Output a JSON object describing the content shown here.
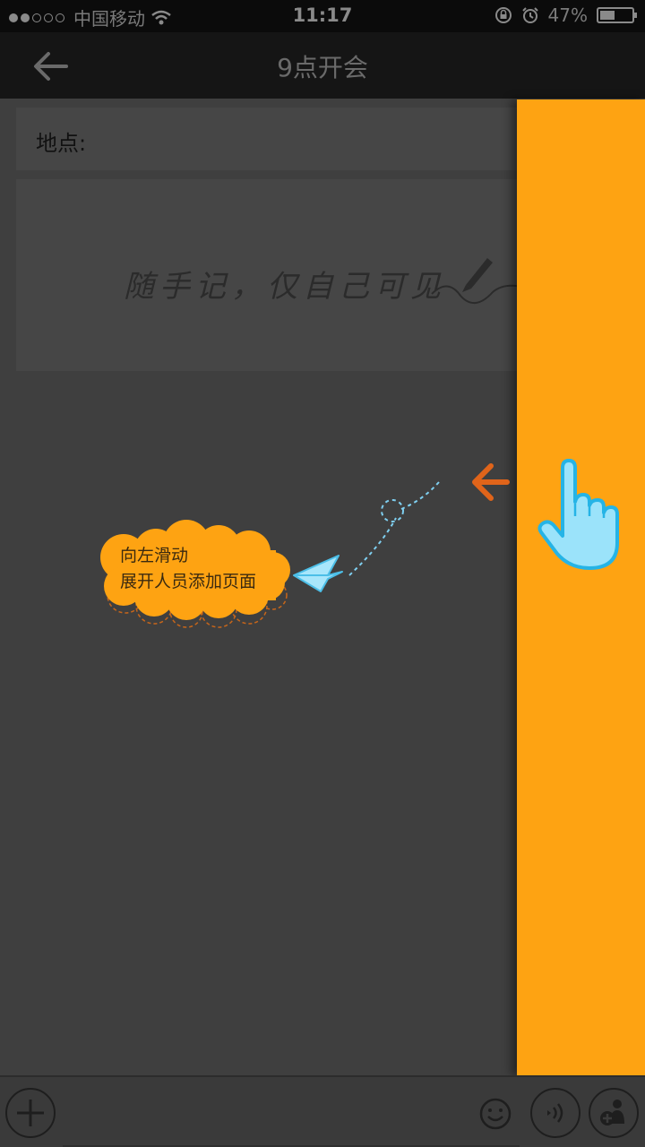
{
  "status_bar": {
    "carrier": "中国移动",
    "time": "11:17",
    "battery": "47%",
    "battery_level": 0.47,
    "signal_icon": "signal-dots-icon",
    "wifi_icon": "wifi-icon",
    "lock_icon": "rotation-lock-icon",
    "alarm_icon": "alarm-icon"
  },
  "nav": {
    "title": "9点开会",
    "back_icon": "back-arrow-icon"
  },
  "form": {
    "location_label": "地点:",
    "note_placeholder": "随手记，仅自己可见",
    "pen_icon": "pen-icon"
  },
  "tutorial": {
    "line1": "向左滑动",
    "line2": "展开人员添加页面",
    "arrow_icon": "left-arrow-icon",
    "hand_icon": "pointing-hand-icon",
    "plane_icon": "paper-plane-icon"
  },
  "bottom_bar": {
    "add_icon": "plus-icon",
    "emoji_icon": "smiley-icon",
    "voice_icon": "voice-icon",
    "person_icon": "add-person-icon"
  },
  "colors": {
    "drawer": "#fea312",
    "arrow": "#e0641a",
    "cloud": "#fea312",
    "hand": "#9be3fa"
  }
}
